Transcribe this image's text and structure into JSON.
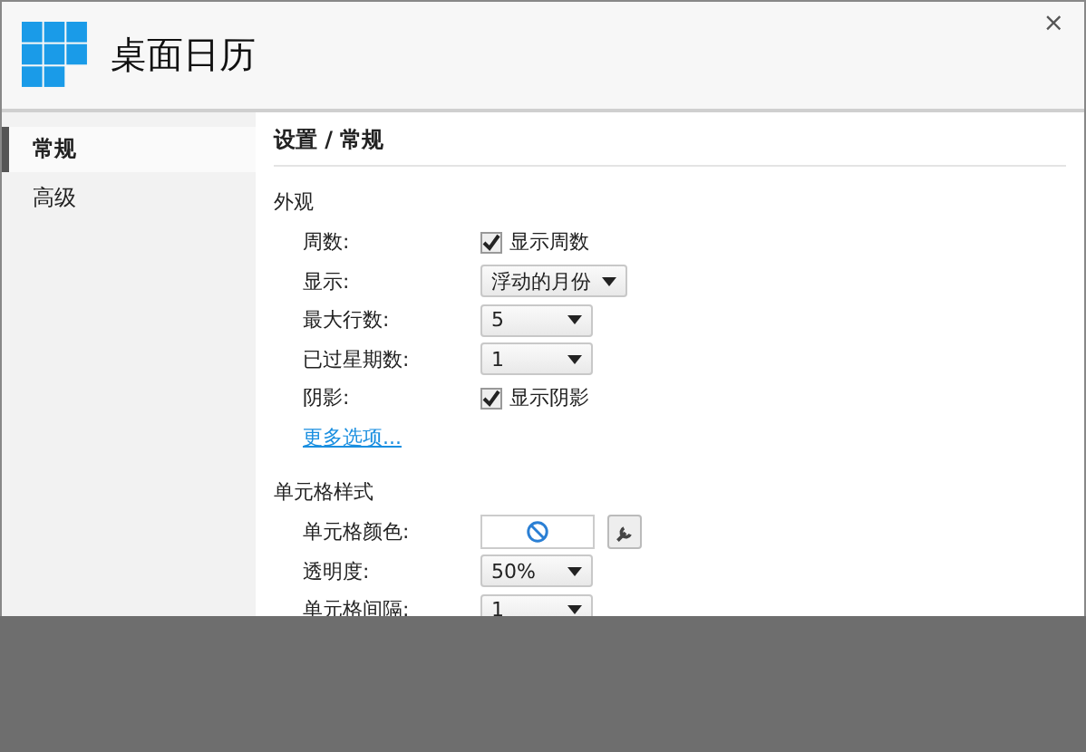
{
  "window": {
    "title": "桌面日历",
    "close": "×"
  },
  "sidebar": {
    "items": [
      {
        "label": "常规",
        "selected": true
      },
      {
        "label": "高级",
        "selected": false
      }
    ]
  },
  "page": {
    "heading": "设置 / 常规",
    "sections": [
      {
        "title": "外观",
        "rows": [
          {
            "kind": "checkbox",
            "label": "周数:",
            "text": "显示周数",
            "checked": true
          },
          {
            "kind": "dropdown",
            "label": "显示:",
            "value": "浮动的月份"
          },
          {
            "kind": "dropdown",
            "label": "最大行数:",
            "value": "5"
          },
          {
            "kind": "dropdown",
            "label": "已过星期数:",
            "value": "1"
          },
          {
            "kind": "checkbox",
            "label": "阴影:",
            "text": "显示阴影",
            "checked": true
          },
          {
            "kind": "link",
            "text": "更多选项..."
          }
        ]
      },
      {
        "title": "单元格样式",
        "rows": [
          {
            "kind": "color",
            "label": "单元格颜色:"
          },
          {
            "kind": "dropdown",
            "label": "透明度:",
            "value": "50%"
          },
          {
            "kind": "dropdown",
            "label": "单元格间隔:",
            "value": "1"
          }
        ]
      }
    ]
  }
}
